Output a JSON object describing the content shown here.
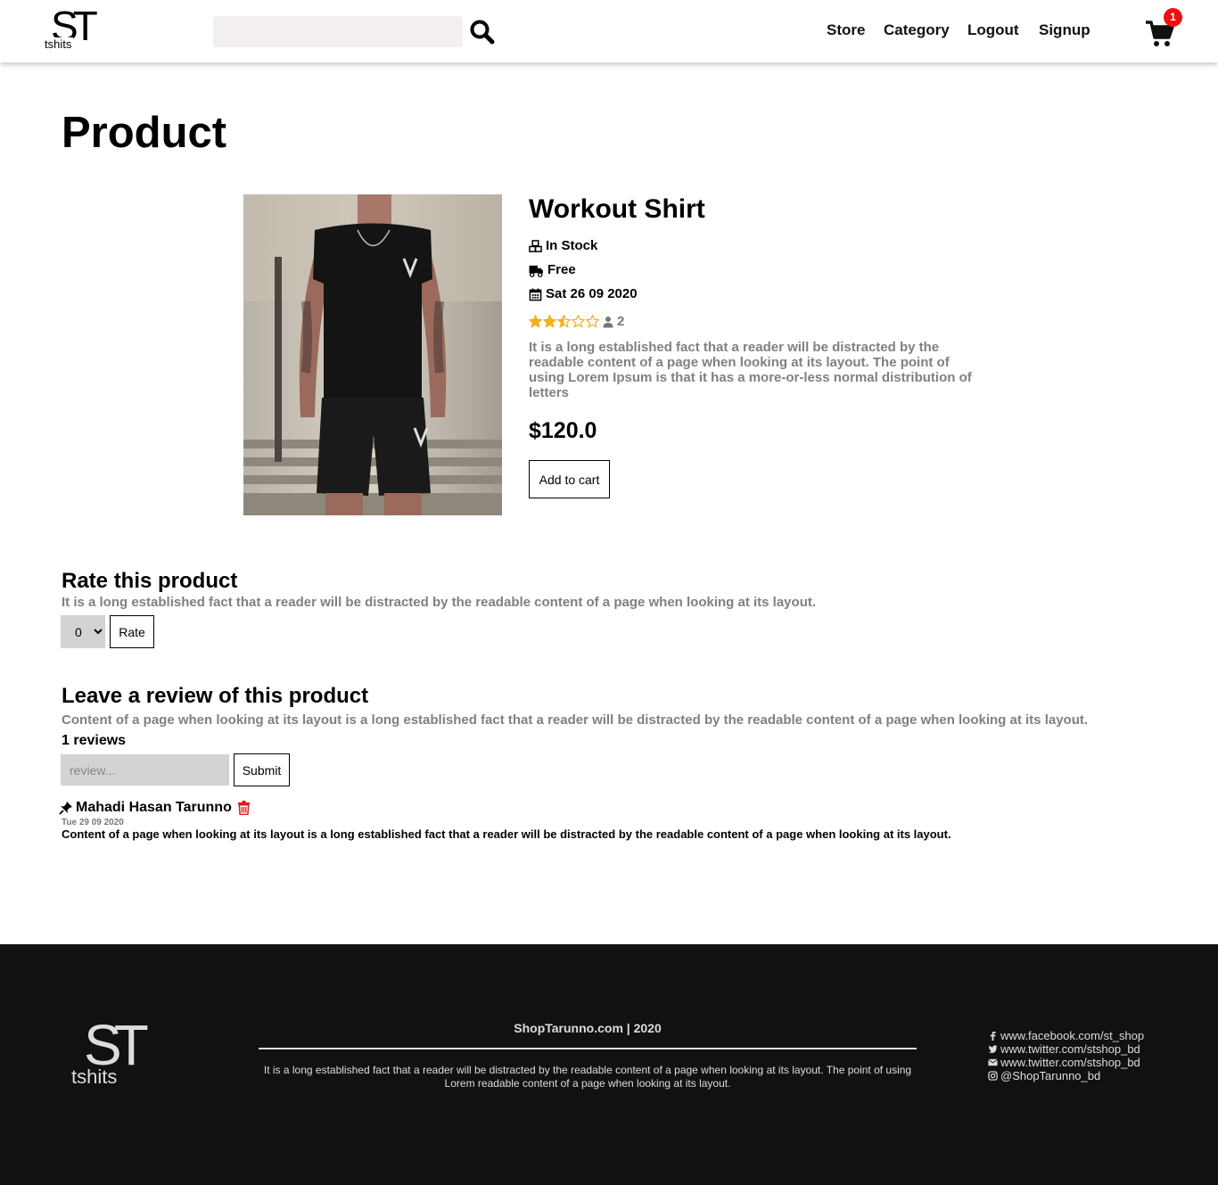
{
  "nav": {
    "logo_big": "ST",
    "logo_small": "tshits",
    "search_value": "",
    "links": [
      "Store",
      "Category",
      "Logout",
      "Signup"
    ],
    "cart_count": "1"
  },
  "page": {
    "title": "Product"
  },
  "product": {
    "name": "Workout Shirt",
    "stock": "In Stock",
    "shipping": "Free",
    "date": "Sat 26 09 2020",
    "rating": 2.5,
    "rating_max": 5,
    "rating_count": "2",
    "description": "It is a long established fact that a reader will be distracted by the readable content of a page when looking at its layout. The point of using Lorem Ipsum is that it has a more-or-less normal distribution of letters",
    "price": "$120.0",
    "add_to_cart": "Add to cart"
  },
  "rate_section": {
    "title": "Rate this product",
    "description": "It is a long established fact that a reader will be distracted by the readable content of a page when looking at its layout.",
    "selected": "0",
    "button": "Rate"
  },
  "review_section": {
    "title": "Leave a review of this product",
    "description": "Content of a page when looking at its layout is a long established fact that a reader will be distracted by the readable content of a page when looking at its layout.",
    "count": "1 reviews",
    "placeholder": "review...",
    "button": "Submit",
    "reviews": [
      {
        "author": "Mahadi Hasan Tarunno",
        "date": "Tue 29 09 2020",
        "text": "Content of a page when looking at its layout is a long established fact that a reader will be distracted by the readable content of a page when looking at its layout."
      }
    ]
  },
  "footer": {
    "logo_big": "ST",
    "logo_small": "tshits",
    "brand": "ShopTarunno.com | 2020",
    "description": "It is a long established fact that a reader will be distracted by the readable content of a page when looking at its layout. The point of using Lorem readable content of a page when looking at its layout.",
    "social": [
      {
        "icon": "facebook-icon",
        "text": "www.facebook.com/st_shop"
      },
      {
        "icon": "twitter-icon",
        "text": "www.twitter.com/stshop_bd"
      },
      {
        "icon": "envelope-icon",
        "text": "www.twitter.com/stshop_bd"
      },
      {
        "icon": "instagram-icon",
        "text": "@ShopTarunno_bd"
      }
    ]
  },
  "colors": {
    "star": "#f2b01e",
    "badge": "#ee1111",
    "trash": "#e01818",
    "footer_bg": "#111111",
    "input_bg": "#d3d3d3",
    "search_bg": "#f3efee"
  }
}
